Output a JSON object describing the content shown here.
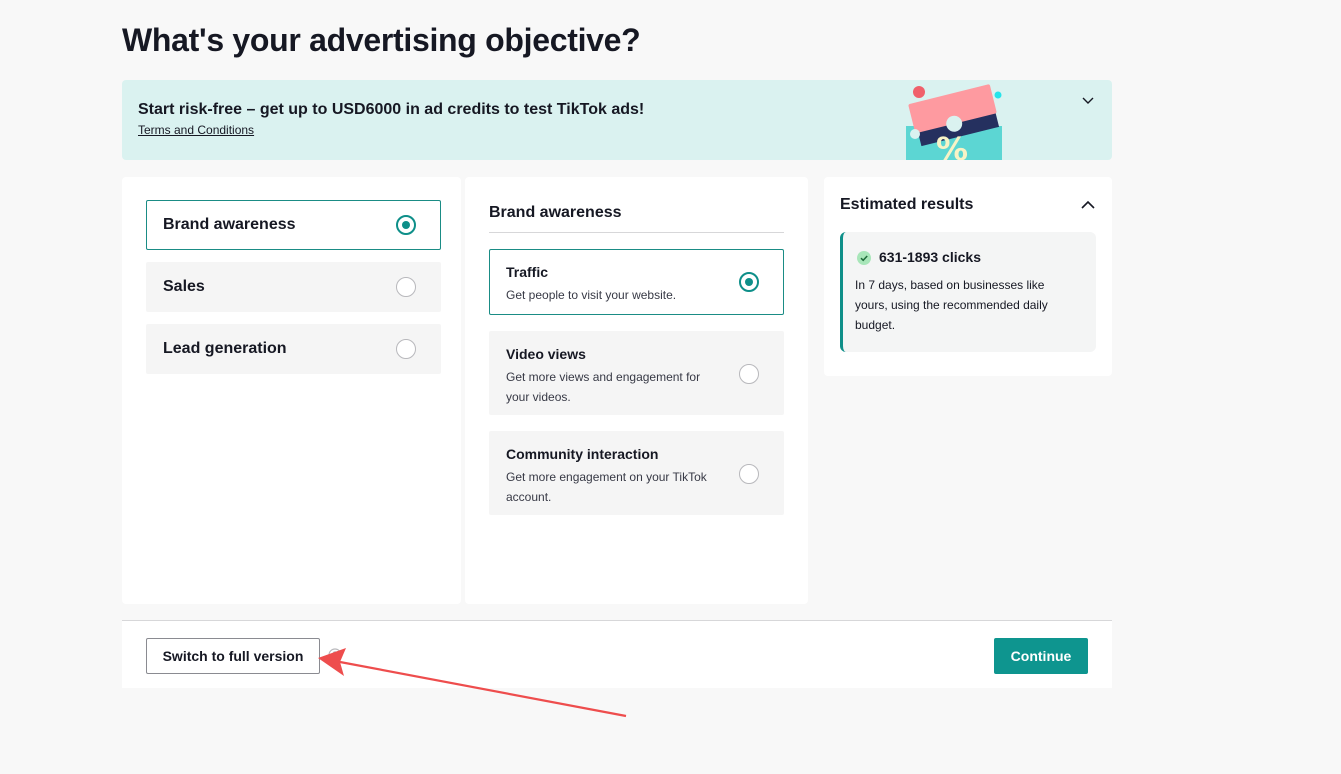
{
  "page": {
    "title": "What's your advertising objective?"
  },
  "banner": {
    "text": "Start risk-free – get up to USD6000 in ad credits to test TikTok ads!",
    "link": "Terms and Conditions",
    "illustration_glyph": "%"
  },
  "objectives": [
    {
      "label": "Brand awareness",
      "selected": true
    },
    {
      "label": "Sales",
      "selected": false
    },
    {
      "label": "Lead generation",
      "selected": false
    }
  ],
  "detail": {
    "heading": "Brand awareness",
    "options": [
      {
        "title": "Traffic",
        "description": "Get people to visit your website.",
        "selected": true
      },
      {
        "title": "Video views",
        "description": "Get more views and engagement for your videos.",
        "selected": false
      },
      {
        "title": "Community interaction",
        "description": "Get more engagement on your TikTok account.",
        "selected": false
      }
    ]
  },
  "estimate": {
    "title": "Estimated results",
    "clicks": "631-1893 clicks",
    "description": "In 7 days, based on businesses like yours, using the recommended daily budget."
  },
  "footer": {
    "switch_label": "Switch to full version",
    "continue_label": "Continue"
  },
  "colors": {
    "accent": "#0e958f",
    "banner_bg": "#daf2f0",
    "annotation_arrow": "#ee4d4d"
  }
}
